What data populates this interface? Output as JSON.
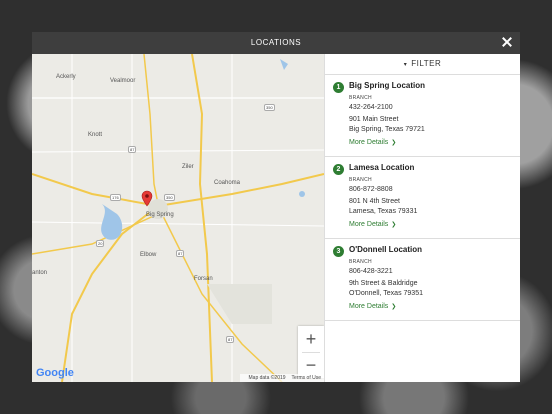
{
  "modal": {
    "title": "LOCATIONS"
  },
  "filter": {
    "label": "FILTER"
  },
  "locations": [
    {
      "number": "1",
      "name": "Big Spring Location",
      "type": "BRANCH",
      "phone": "432-264-2100",
      "address1": "901 Main Street",
      "address2": "Big Spring, Texas 79721",
      "more": "More Details"
    },
    {
      "number": "2",
      "name": "Lamesa Location",
      "type": "BRANCH",
      "phone": "806-872-8808",
      "address1": "801 N 4th Street",
      "address2": "Lamesa, Texas 79331",
      "more": "More Details"
    },
    {
      "number": "3",
      "name": "O'Donnell Location",
      "type": "BRANCH",
      "phone": "806-428-3221",
      "address1": "9th Street & Baldridge",
      "address2": "O'Donnell, Texas 79351",
      "more": "More Details"
    }
  ],
  "map": {
    "places": [
      "Ackerly",
      "Vealmoor",
      "Knott",
      "Ziler",
      "Coahoma",
      "Big Spring",
      "Elbow",
      "Forsan",
      "anton"
    ],
    "shields": [
      "350",
      "87",
      "176",
      "350",
      "20",
      "87",
      "87"
    ],
    "zoom_in": "+",
    "zoom_out": "−",
    "logo": "Google",
    "attribution": "Map data ©2019",
    "terms": "Terms of Use",
    "marker_color": "#e53935"
  },
  "colors": {
    "accent": "#2e7d32",
    "header": "#3e3e3e"
  }
}
